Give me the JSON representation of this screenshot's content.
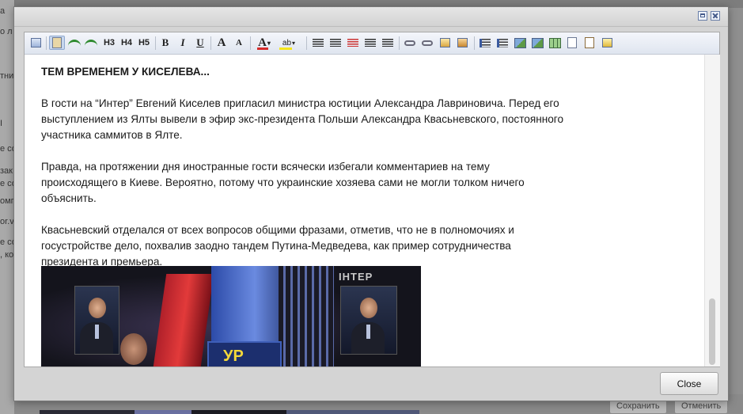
{
  "background": {
    "fragments": [
      "а",
      "о л",
      "",
      "тни",
      "",
      "I",
      "е со",
      "зак",
      "е со",
      "омп",
      "or.v",
      "е со",
      ", ко"
    ],
    "save_label": "Сохранить",
    "cancel_label": "Отменить"
  },
  "toolbar": {
    "h3": "H3",
    "h4": "H4",
    "h5": "H5",
    "bold": "B",
    "italic": "I",
    "underline": "U",
    "grow": "A",
    "shrink": "A",
    "fontcolor": "A",
    "highlight": "ab"
  },
  "article": {
    "heading": "ТЕМ ВРЕМЕНЕМ У КИСЕЛЕВА...",
    "paragraphs": [
      "В гости на “Интер” Евгений Киселев пригласил министра юстиции Александра Лавриновича. Перед его выступлением из Ялты вывели в эфир экс-президента Польши Александра Квасьневского, постоянного участника саммитов в Ялте.",
      "Правда, на протяжении дня иностранные гости всячески избегали комментариев на тему происходящего в Киеве. Вероятно, потому что украинские хозяева сами не могли толком ничего объяснить.",
      "Квасьневский отделался от всех вопросов общими фразами, отметив, что не в полномочиях и госустройстве дело, похвалив заодно тандем Путина-Медведева, как пример сотрудничества президента и премьера."
    ],
    "image_brand": "ІНТЕР",
    "image_logo": "УР"
  },
  "dialog": {
    "close_label": "Close"
  },
  "colors": {
    "font_color_bar": "#d62a2a",
    "highlight_bar": "#f5e61c"
  }
}
